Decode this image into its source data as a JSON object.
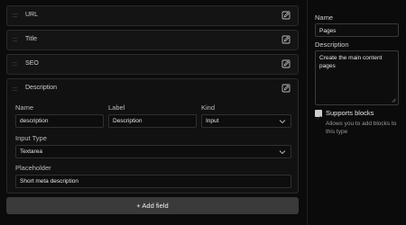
{
  "fields": [
    {
      "label": "URL"
    },
    {
      "label": "Title"
    },
    {
      "label": "SEO"
    }
  ],
  "expanded_field": {
    "label": "Description",
    "name_label": "Name",
    "name_value": "description",
    "label_label": "Label",
    "label_value": "Description",
    "kind_label": "Kind",
    "kind_value": "Input",
    "input_type_label": "Input Type",
    "input_type_value": "Textarea",
    "placeholder_label": "Placeholder",
    "placeholder_value": "Short meta description"
  },
  "add_field_label": "+ Add field",
  "sidebar": {
    "name_label": "Name",
    "name_value": "Pages",
    "description_label": "Description",
    "description_value": "Create the main content pages",
    "supports_blocks_label": "Supports blocks",
    "supports_blocks_desc": "Allows you to add blocks to this type",
    "supports_blocks_checked": true
  },
  "icons": {
    "edit": "edit-icon",
    "drag": "drag-handle-icon",
    "chevron": "chevron-down-icon"
  }
}
